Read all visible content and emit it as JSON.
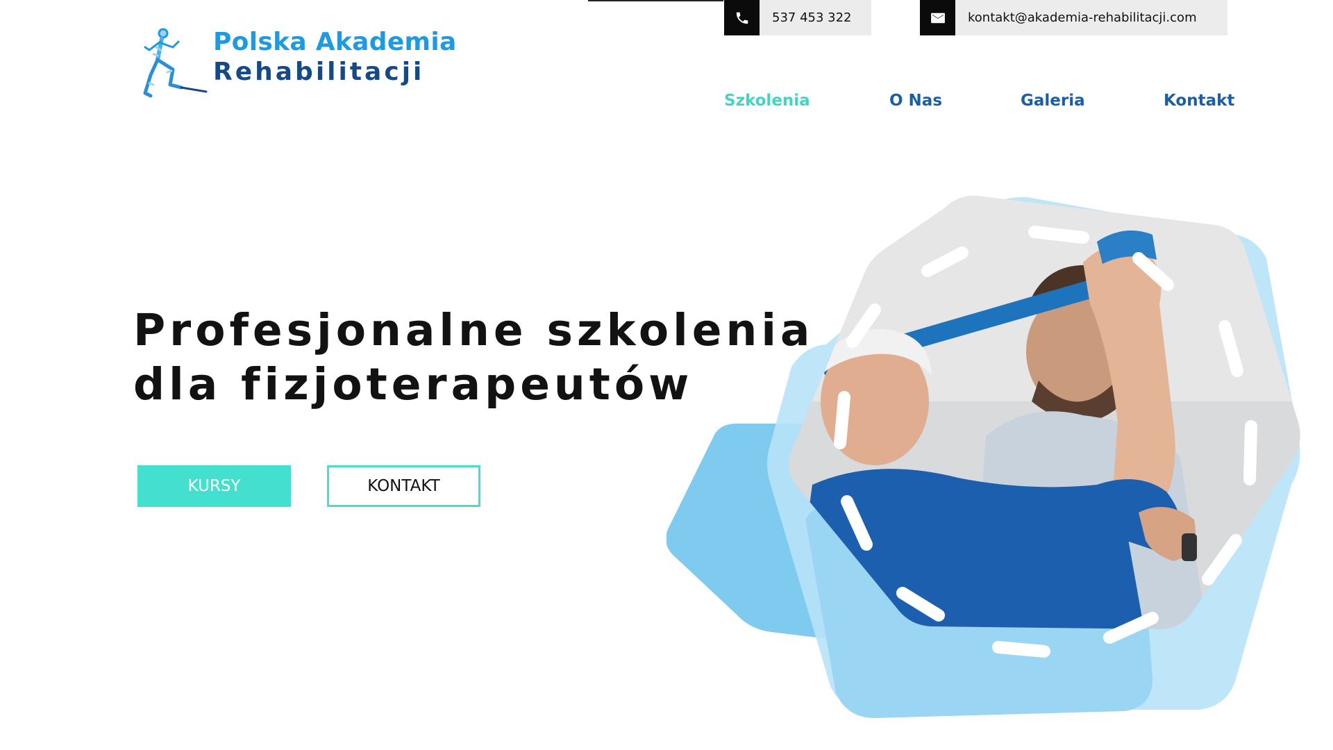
{
  "brand": {
    "line1": "Polska Akademia",
    "line2": "Rehabilitacji",
    "logo_icon": "running-man-anatomy-icon",
    "color_primary": "#1f9ae0",
    "color_dark": "#154a85"
  },
  "contact": {
    "phone": "537 453 322",
    "phone_icon": "phone-icon",
    "email": "kontakt@akademia-rehabilitacji.com",
    "email_icon": "envelope-icon"
  },
  "nav": {
    "items": [
      {
        "label": "Szkolenia",
        "active": true
      },
      {
        "label": "O Nas",
        "active": false
      },
      {
        "label": "Galeria",
        "active": false
      },
      {
        "label": "Kontakt",
        "active": false
      }
    ],
    "active_color": "#43d5c4",
    "color": "#1a5fa6"
  },
  "hero": {
    "title_line1": "Profesjonalne szkolenia",
    "title_line2": "dla fizjoterapeutów",
    "buttons": {
      "primary": "KURSY",
      "secondary": "KONTAKT"
    },
    "accent_color": "#43dfcf"
  }
}
